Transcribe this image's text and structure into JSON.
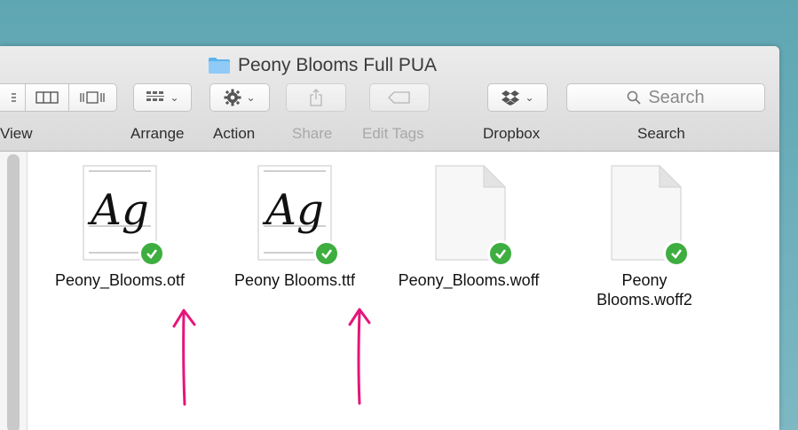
{
  "window": {
    "title": "Peony Blooms Full PUA"
  },
  "toolbar": {
    "view_label": "View",
    "arrange_label": "Arrange",
    "action_label": "Action",
    "share_label": "Share",
    "edit_tags_label": "Edit Tags",
    "dropbox_label": "Dropbox",
    "search_label": "Search",
    "search_placeholder": "Search"
  },
  "files": [
    {
      "name": "Peony_Blooms.otf",
      "preview_text": "Ag",
      "synced": true
    },
    {
      "name": "Peony Blooms.ttf",
      "preview_text": "Ag",
      "synced": true
    },
    {
      "name": "Peony_Blooms.woff",
      "synced": true
    },
    {
      "name": "Peony Blooms.woff2",
      "synced": true
    }
  ],
  "colors": {
    "annotation_arrow": "#e5157a",
    "sync_check": "#3dae3f"
  }
}
